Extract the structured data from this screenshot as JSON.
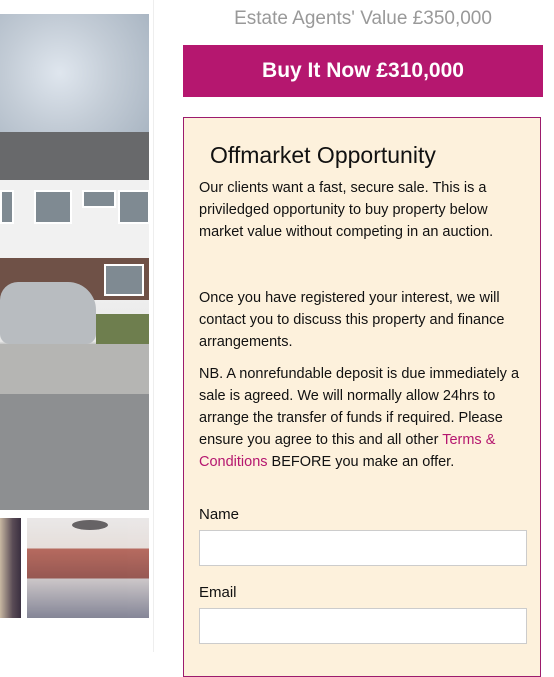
{
  "pricing": {
    "estate_agents_value": "Estate Agents' Value £350,000",
    "buy_now_label": "Buy It Now £310,000"
  },
  "offer": {
    "title": "Offmarket Opportunity",
    "paragraph1": "Our clients want a fast, secure sale. This is a priviledged opportunity to buy property below market value without competing in an auction.",
    "paragraph2": "Once you have registered your interest, we will contact you to discuss this property and finance arrangements.",
    "paragraph3_before_link": "NB. A nonrefundable deposit is due immediately a sale is agreed. We will normally allow 24hrs to arrange the transfer of funds if required. Please ensure you agree to this and all other ",
    "terms_link": "Terms & Conditions",
    "paragraph3_after_link": " BEFORE you make an offer."
  },
  "form": {
    "name_label": "Name",
    "name_value": "",
    "email_label": "Email",
    "email_value": ""
  },
  "colors": {
    "accent": "#b5176f",
    "panel_background": "#fdf1dc",
    "muted_text": "#999999"
  }
}
